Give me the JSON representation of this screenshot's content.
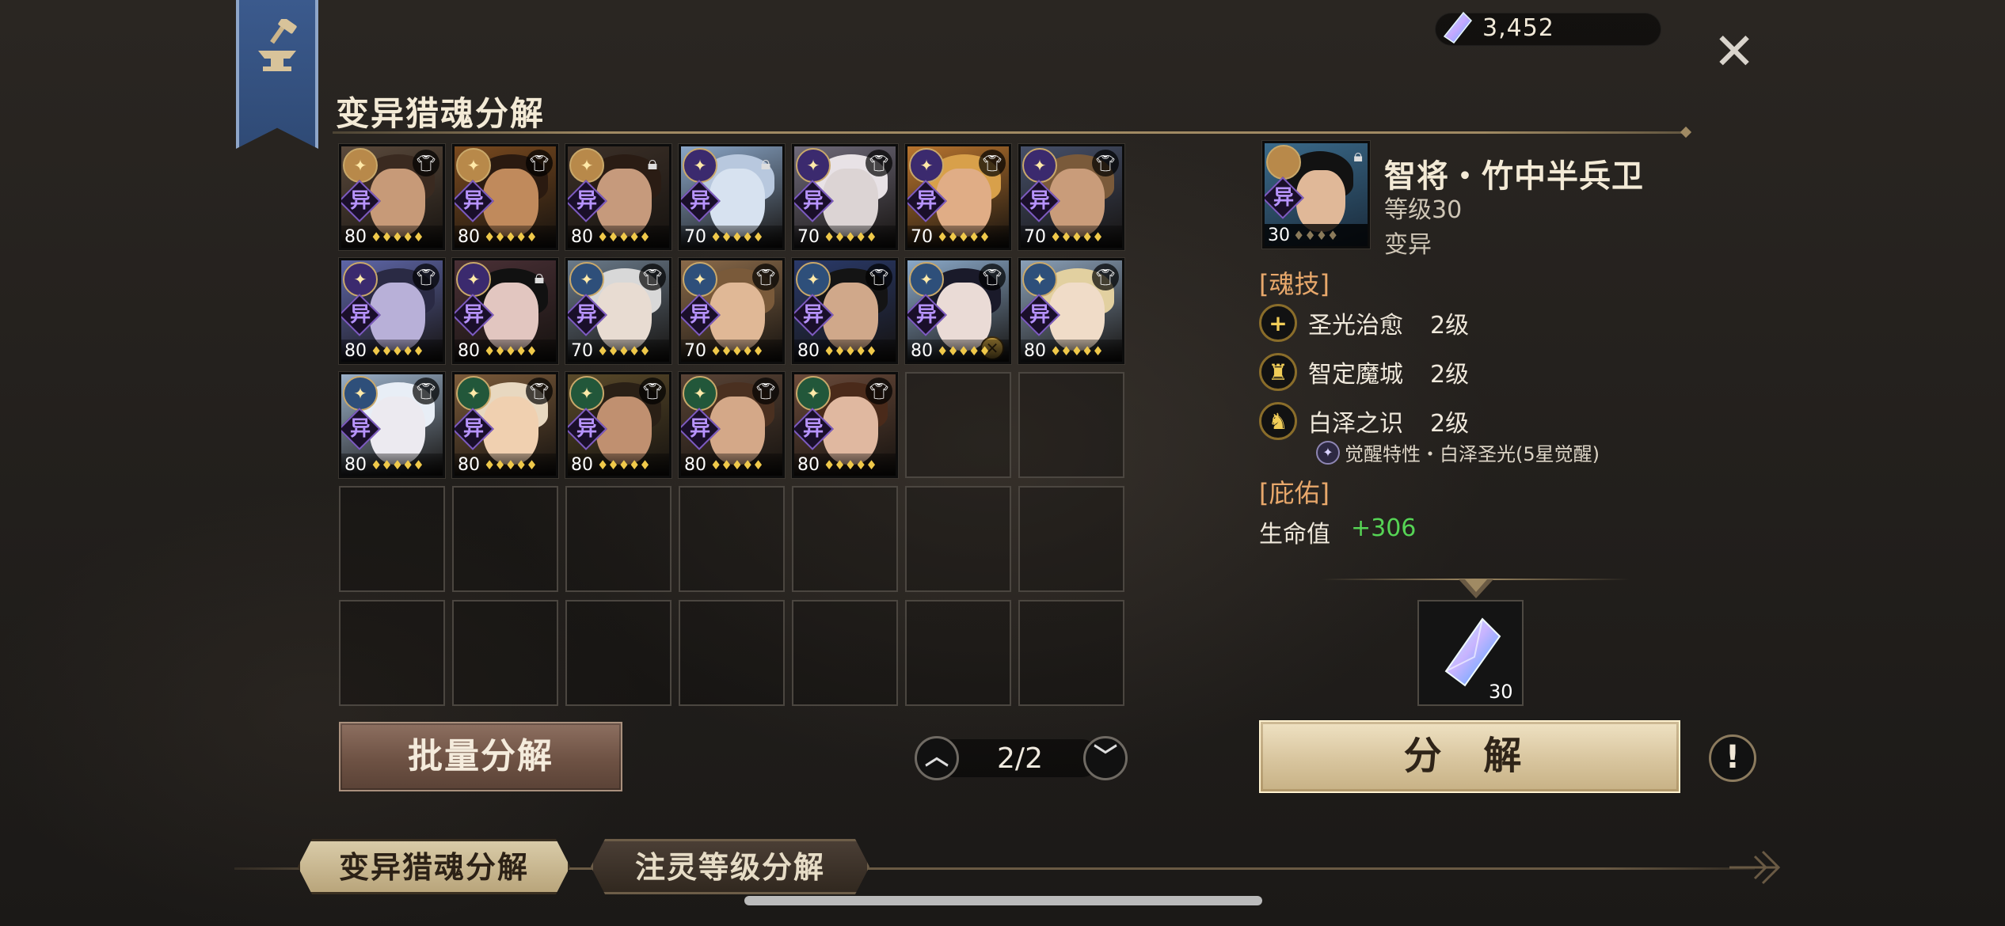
{
  "currency": {
    "icon": "crystal-icon",
    "value": "3,452"
  },
  "page_title": "变异猎魂分解",
  "close_icon": "close-icon",
  "grid": {
    "cards": [
      {
        "level": "80",
        "stars": "♦♦♦♦♦",
        "badge": "gold",
        "corner": "shirt",
        "colors": [
          "#5b4a3c",
          "#c79a78",
          "#3a2a20"
        ]
      },
      {
        "level": "80",
        "stars": "♦♦♦♦♦",
        "badge": "gold",
        "corner": "shirt",
        "colors": [
          "#7a4a1f",
          "#c08a5c",
          "#2a1a10"
        ]
      },
      {
        "level": "80",
        "stars": "♦♦♦♦♦",
        "badge": "gold",
        "corner": "lock",
        "colors": [
          "#3c3028",
          "#c69a7c",
          "#2a1c14"
        ]
      },
      {
        "level": "70",
        "stars": "♦♦♦♦♦",
        "badge": "purple",
        "corner": "lock",
        "colors": [
          "#8aa6c8",
          "#d7e2f0",
          "#b8c8de"
        ]
      },
      {
        "level": "70",
        "stars": "♦♦♦♦♦",
        "badge": "purple",
        "corner": "shirt",
        "colors": [
          "#6f6a7a",
          "#dcd4d4",
          "#e8e2e6"
        ]
      },
      {
        "level": "70",
        "stars": "♦♦♦♦♦",
        "badge": "purple",
        "corner": "shirt",
        "colors": [
          "#b8742e",
          "#e0ad86",
          "#d8a04a"
        ]
      },
      {
        "level": "70",
        "stars": "♦♦♦♦♦",
        "badge": "purple",
        "corner": "shirt",
        "colors": [
          "#46506a",
          "#c99c7a",
          "#7a5a3a"
        ]
      },
      {
        "level": "80",
        "stars": "♦♦♦♦♦",
        "badge": "purple",
        "corner": "shirt",
        "colors": [
          "#5e66a8",
          "#b8b0d8",
          "#2a2a44"
        ]
      },
      {
        "level": "80",
        "stars": "♦♦♦♦♦",
        "badge": "purple",
        "corner": "lock",
        "colors": [
          "#4a3036",
          "#e2c6c0",
          "#111111"
        ]
      },
      {
        "level": "70",
        "stars": "♦♦♦♦♦",
        "badge": "blue",
        "corner": "shirt",
        "colors": [
          "#6a7a8a",
          "#e8dcd2",
          "#d8d8d8"
        ]
      },
      {
        "level": "70",
        "stars": "♦♦♦♦♦",
        "badge": "blue",
        "corner": "shirt",
        "colors": [
          "#8a6a4a",
          "#e0b896",
          "#7a5a3a"
        ]
      },
      {
        "level": "80",
        "stars": "♦♦♦♦♦",
        "badge": "blue",
        "corner": "shirt",
        "colors": [
          "#2a3a6a",
          "#d0a88a",
          "#141414"
        ]
      },
      {
        "level": "80",
        "stars": "♦♦♦♦♦",
        "badge": "blue",
        "corner": "shirt",
        "colors": [
          "#8aa8c8",
          "#eadbd6",
          "#1a1a2a"
        ],
        "cross": true
      },
      {
        "level": "80",
        "stars": "♦♦♦♦♦",
        "badge": "blue",
        "corner": "shirt",
        "colors": [
          "#8aa0b8",
          "#f0dcc8",
          "#e2d0a0"
        ]
      },
      {
        "level": "80",
        "stars": "♦♦♦♦♦",
        "badge": "blue",
        "corner": "shirt",
        "colors": [
          "#9ab0c8",
          "#eceaf0",
          "#e8eef6"
        ]
      },
      {
        "level": "80",
        "stars": "♦♦♦♦♦",
        "badge": "green",
        "corner": "shirt",
        "colors": [
          "#7a5a3a",
          "#f0d0b0",
          "#e8d8c0"
        ]
      },
      {
        "level": "80",
        "stars": "♦♦♦♦♦",
        "badge": "green",
        "corner": "shirt",
        "colors": [
          "#5a4a2a",
          "#c09070",
          "#2a2016"
        ]
      },
      {
        "level": "80",
        "stars": "♦♦♦♦♦",
        "badge": "green",
        "corner": "shirt",
        "colors": [
          "#5a4436",
          "#d4a888",
          "#4a3020"
        ]
      },
      {
        "level": "80",
        "stars": "♦♦♦♦♦",
        "badge": "green",
        "corner": "shirt",
        "colors": [
          "#6a4a3a",
          "#e0b8a0",
          "#4a2a1a"
        ]
      }
    ],
    "empty_slots": 16,
    "yi_label": "异"
  },
  "batch_button": "批量分解",
  "pagination": {
    "text": "2/2",
    "prev_icon": "chevron-up-icon",
    "next_icon": "chevron-down-icon"
  },
  "detail": {
    "card_level": "30",
    "card_stars": "♦♦♦♦",
    "name": "智将・竹中半兵卫",
    "level": "等级30",
    "type": "变异",
    "skills_header": "[魂技]",
    "skills": [
      {
        "name": "圣光治愈",
        "level": "2级",
        "icon": "plus-icon",
        "glyph": "+"
      },
      {
        "name": "智定魔城",
        "level": "2级",
        "icon": "helmet-icon",
        "glyph": "♜"
      },
      {
        "name": "白泽之识",
        "level": "2级",
        "icon": "beast-icon",
        "glyph": "♞"
      }
    ],
    "awaken_text": "觉醒特性・白泽圣光(5星觉醒)",
    "blessing_header": "[庇佑]",
    "hp_label": "生命值",
    "hp_value": "+306",
    "reward": {
      "icon": "crystal-icon",
      "count": "30"
    },
    "decompose_button": "分 解",
    "info_icon": "exclamation-icon",
    "info_glyph": "!"
  },
  "tabs": [
    {
      "label": "变异猎魂分解",
      "active": true
    },
    {
      "label": "注灵等级分解",
      "active": false
    }
  ],
  "colors": {
    "badge_gold": "#b8894a",
    "badge_purple": "#3b2a6e",
    "badge_blue": "#2e4f7a",
    "badge_green": "#22573a",
    "accent_orange": "#e8a86b",
    "hp_green": "#56d455"
  }
}
